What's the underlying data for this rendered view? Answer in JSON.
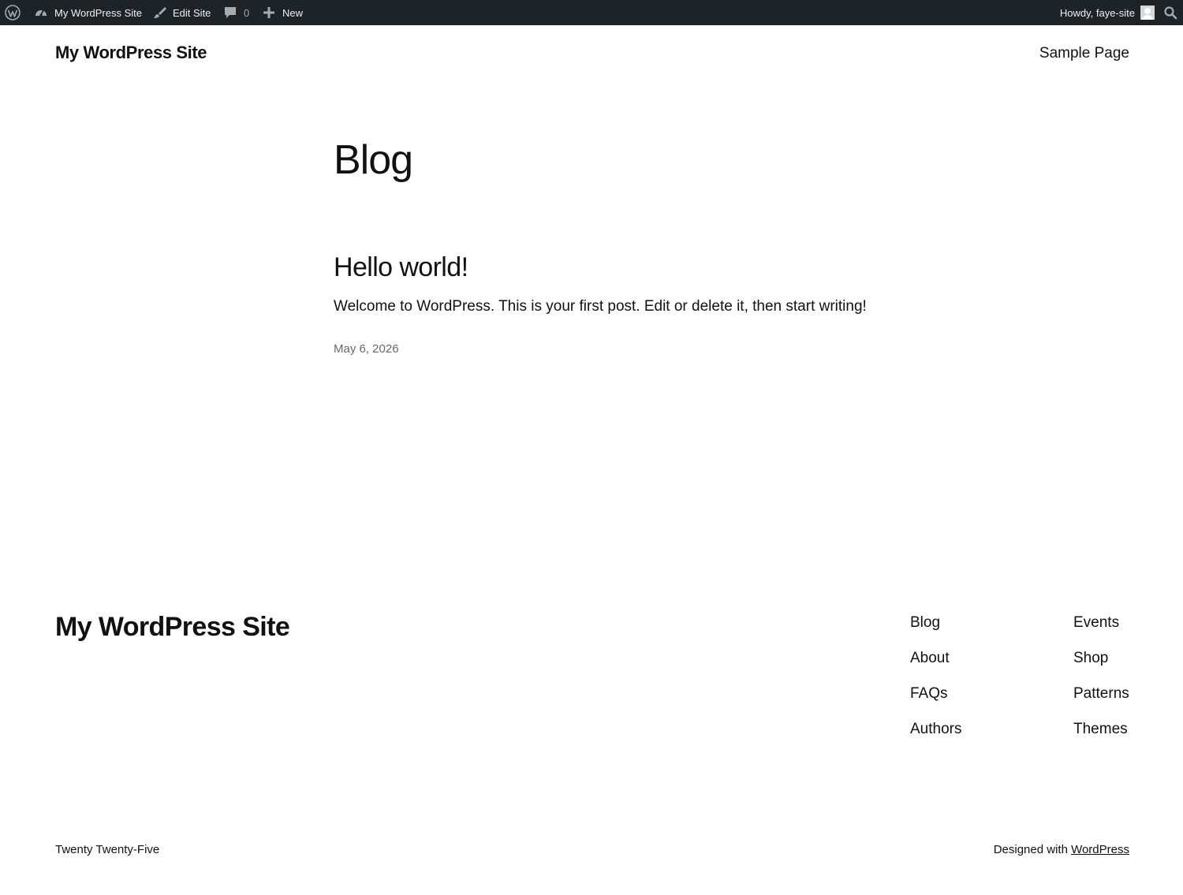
{
  "admin_bar": {
    "wp_logo_icon": "wordpress-logo-icon",
    "site_name": "My WordPress Site",
    "edit_site": "Edit Site",
    "comments_count": "0",
    "new_label": "New",
    "howdy": "Howdy, faye-site",
    "background_color": "#1d2327"
  },
  "header": {
    "site_title": "My WordPress Site",
    "nav": [
      "Sample Page"
    ]
  },
  "main": {
    "page_title": "Blog",
    "posts": [
      {
        "title": "Hello world!",
        "excerpt": "Welcome to WordPress. This is your first post. Edit or delete it, then start writing!",
        "date": "May 6, 2026"
      }
    ]
  },
  "footer": {
    "site_title": "My WordPress Site",
    "nav_col_1": [
      "Blog",
      "About",
      "FAQs",
      "Authors"
    ],
    "nav_col_2": [
      "Events",
      "Shop",
      "Patterns",
      "Themes"
    ],
    "theme_name": "Twenty Twenty-Five",
    "designed_with": "Designed with",
    "designed_with_link": "WordPress"
  }
}
